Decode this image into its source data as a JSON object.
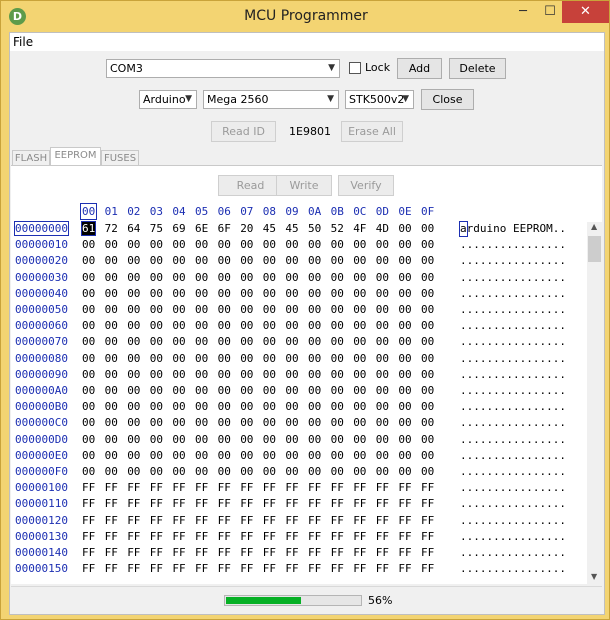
{
  "window": {
    "title": "MCU Programmer",
    "app_icon_letter": "D",
    "minimize": "─",
    "maximize": "☐",
    "close": "✕"
  },
  "menu": {
    "file": "File"
  },
  "port": {
    "value": "COM3",
    "lock_label": "Lock",
    "add_label": "Add",
    "delete_label": "Delete"
  },
  "device": {
    "family": "Arduino",
    "model": "Mega 2560",
    "protocol": "STK500v2",
    "close_label": "Close"
  },
  "id": {
    "read_id_label": "Read ID",
    "id_value": "1E9801",
    "erase_all_label": "Erase All"
  },
  "tabs": [
    {
      "label": "FLASH"
    },
    {
      "label": "EEPROM"
    },
    {
      "label": "FUSES"
    }
  ],
  "actions": {
    "read": "Read",
    "write": "Write",
    "verify": "Verify"
  },
  "hex": {
    "columns": [
      "00",
      "01",
      "02",
      "03",
      "04",
      "05",
      "06",
      "07",
      "08",
      "09",
      "0A",
      "0B",
      "0C",
      "0D",
      "0E",
      "0F"
    ],
    "rows": [
      {
        "addr": "00000000",
        "bytes": [
          "61",
          "72",
          "64",
          "75",
          "69",
          "6E",
          "6F",
          "20",
          "45",
          "45",
          "50",
          "52",
          "4F",
          "4D",
          "00",
          "00"
        ],
        "ascii": "arduino EEPROM.."
      },
      {
        "addr": "00000010",
        "bytes": [
          "00",
          "00",
          "00",
          "00",
          "00",
          "00",
          "00",
          "00",
          "00",
          "00",
          "00",
          "00",
          "00",
          "00",
          "00",
          "00"
        ],
        "ascii": "................"
      },
      {
        "addr": "00000020",
        "bytes": [
          "00",
          "00",
          "00",
          "00",
          "00",
          "00",
          "00",
          "00",
          "00",
          "00",
          "00",
          "00",
          "00",
          "00",
          "00",
          "00"
        ],
        "ascii": "................"
      },
      {
        "addr": "00000030",
        "bytes": [
          "00",
          "00",
          "00",
          "00",
          "00",
          "00",
          "00",
          "00",
          "00",
          "00",
          "00",
          "00",
          "00",
          "00",
          "00",
          "00"
        ],
        "ascii": "................"
      },
      {
        "addr": "00000040",
        "bytes": [
          "00",
          "00",
          "00",
          "00",
          "00",
          "00",
          "00",
          "00",
          "00",
          "00",
          "00",
          "00",
          "00",
          "00",
          "00",
          "00"
        ],
        "ascii": "................"
      },
      {
        "addr": "00000050",
        "bytes": [
          "00",
          "00",
          "00",
          "00",
          "00",
          "00",
          "00",
          "00",
          "00",
          "00",
          "00",
          "00",
          "00",
          "00",
          "00",
          "00"
        ],
        "ascii": "................"
      },
      {
        "addr": "00000060",
        "bytes": [
          "00",
          "00",
          "00",
          "00",
          "00",
          "00",
          "00",
          "00",
          "00",
          "00",
          "00",
          "00",
          "00",
          "00",
          "00",
          "00"
        ],
        "ascii": "................"
      },
      {
        "addr": "00000070",
        "bytes": [
          "00",
          "00",
          "00",
          "00",
          "00",
          "00",
          "00",
          "00",
          "00",
          "00",
          "00",
          "00",
          "00",
          "00",
          "00",
          "00"
        ],
        "ascii": "................"
      },
      {
        "addr": "00000080",
        "bytes": [
          "00",
          "00",
          "00",
          "00",
          "00",
          "00",
          "00",
          "00",
          "00",
          "00",
          "00",
          "00",
          "00",
          "00",
          "00",
          "00"
        ],
        "ascii": "................"
      },
      {
        "addr": "00000090",
        "bytes": [
          "00",
          "00",
          "00",
          "00",
          "00",
          "00",
          "00",
          "00",
          "00",
          "00",
          "00",
          "00",
          "00",
          "00",
          "00",
          "00"
        ],
        "ascii": "................"
      },
      {
        "addr": "000000A0",
        "bytes": [
          "00",
          "00",
          "00",
          "00",
          "00",
          "00",
          "00",
          "00",
          "00",
          "00",
          "00",
          "00",
          "00",
          "00",
          "00",
          "00"
        ],
        "ascii": "................"
      },
      {
        "addr": "000000B0",
        "bytes": [
          "00",
          "00",
          "00",
          "00",
          "00",
          "00",
          "00",
          "00",
          "00",
          "00",
          "00",
          "00",
          "00",
          "00",
          "00",
          "00"
        ],
        "ascii": "................"
      },
      {
        "addr": "000000C0",
        "bytes": [
          "00",
          "00",
          "00",
          "00",
          "00",
          "00",
          "00",
          "00",
          "00",
          "00",
          "00",
          "00",
          "00",
          "00",
          "00",
          "00"
        ],
        "ascii": "................"
      },
      {
        "addr": "000000D0",
        "bytes": [
          "00",
          "00",
          "00",
          "00",
          "00",
          "00",
          "00",
          "00",
          "00",
          "00",
          "00",
          "00",
          "00",
          "00",
          "00",
          "00"
        ],
        "ascii": "................"
      },
      {
        "addr": "000000E0",
        "bytes": [
          "00",
          "00",
          "00",
          "00",
          "00",
          "00",
          "00",
          "00",
          "00",
          "00",
          "00",
          "00",
          "00",
          "00",
          "00",
          "00"
        ],
        "ascii": "................"
      },
      {
        "addr": "000000F0",
        "bytes": [
          "00",
          "00",
          "00",
          "00",
          "00",
          "00",
          "00",
          "00",
          "00",
          "00",
          "00",
          "00",
          "00",
          "00",
          "00",
          "00"
        ],
        "ascii": "................"
      },
      {
        "addr": "00000100",
        "bytes": [
          "FF",
          "FF",
          "FF",
          "FF",
          "FF",
          "FF",
          "FF",
          "FF",
          "FF",
          "FF",
          "FF",
          "FF",
          "FF",
          "FF",
          "FF",
          "FF"
        ],
        "ascii": "................"
      },
      {
        "addr": "00000110",
        "bytes": [
          "FF",
          "FF",
          "FF",
          "FF",
          "FF",
          "FF",
          "FF",
          "FF",
          "FF",
          "FF",
          "FF",
          "FF",
          "FF",
          "FF",
          "FF",
          "FF"
        ],
        "ascii": "................"
      },
      {
        "addr": "00000120",
        "bytes": [
          "FF",
          "FF",
          "FF",
          "FF",
          "FF",
          "FF",
          "FF",
          "FF",
          "FF",
          "FF",
          "FF",
          "FF",
          "FF",
          "FF",
          "FF",
          "FF"
        ],
        "ascii": "................"
      },
      {
        "addr": "00000130",
        "bytes": [
          "FF",
          "FF",
          "FF",
          "FF",
          "FF",
          "FF",
          "FF",
          "FF",
          "FF",
          "FF",
          "FF",
          "FF",
          "FF",
          "FF",
          "FF",
          "FF"
        ],
        "ascii": "................"
      },
      {
        "addr": "00000140",
        "bytes": [
          "FF",
          "FF",
          "FF",
          "FF",
          "FF",
          "FF",
          "FF",
          "FF",
          "FF",
          "FF",
          "FF",
          "FF",
          "FF",
          "FF",
          "FF",
          "FF"
        ],
        "ascii": "................"
      },
      {
        "addr": "00000150",
        "bytes": [
          "FF",
          "FF",
          "FF",
          "FF",
          "FF",
          "FF",
          "FF",
          "FF",
          "FF",
          "FF",
          "FF",
          "FF",
          "FF",
          "FF",
          "FF",
          "FF"
        ],
        "ascii": "................"
      }
    ]
  },
  "status": {
    "progress_percent": 56,
    "progress_label": "56%"
  },
  "colors": {
    "titlebar": "#f3d472",
    "address_blue": "#1c2fb2",
    "progress_green": "#06b025",
    "close_red": "#c7413a"
  }
}
